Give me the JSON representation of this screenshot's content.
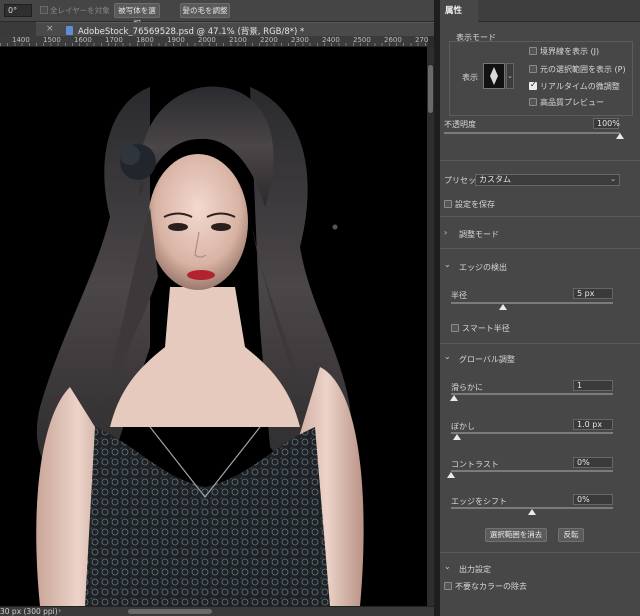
{
  "options_bar": {
    "angle_value": "0°",
    "sample_all_layers": "全レイヤーを対象",
    "select_subject": "被写体を選択",
    "refine_hair": "髪の毛を調整"
  },
  "document": {
    "tab_title": "AdobeStock_76569528.psd @ 47.1% (背景, RGB/8*) *"
  },
  "ruler": {
    "ticks": [
      "1400",
      "1500",
      "1600",
      "1700",
      "1800",
      "1900",
      "2000",
      "2100",
      "2200",
      "2300",
      "2400",
      "2500",
      "2600",
      "2700"
    ]
  },
  "status": {
    "text": "30 px (300 ppi)",
    "arrow": "›"
  },
  "panel": {
    "tab": "属性",
    "view_mode": {
      "title": "表示モード",
      "view_label": "表示",
      "show_edge": "境界線を表示 (J)",
      "show_original": "元の選択範囲を表示 (P)",
      "realtime_refine": "リアルタイムの微調整",
      "high_quality_preview": "高品質プレビュー",
      "checks": {
        "show_edge": false,
        "show_original": false,
        "realtime_refine": true,
        "high_quality_preview": false
      }
    },
    "opacity": {
      "label": "不透明度",
      "value": "100%",
      "level": 1.0
    },
    "preset": {
      "label": "プリセット",
      "value": "カスタム"
    },
    "save_settings": "設定を保存",
    "adjust_mode": "調整モード",
    "edge_detection": {
      "title": "エッジの検出",
      "radius_label": "半径",
      "radius_value": "5 px",
      "radius_level": 0.32,
      "smart_radius": "スマート半径"
    },
    "global_refine": {
      "title": "グローバル調整",
      "smooth_label": "滑らかに",
      "smooth_value": "1",
      "smooth_level": 0.02,
      "feather_label": "ぼかし",
      "feather_value": "1.0 px",
      "feather_level": 0.04,
      "contrast_label": "コントラスト",
      "contrast_value": "0%",
      "contrast_level": 0.0,
      "shift_edge_label": "エッジをシフト",
      "shift_edge_value": "0%",
      "shift_edge_level": 0.5
    },
    "clear_selection": "選択範囲を消去",
    "invert": "反転",
    "output": {
      "title": "出力設定",
      "decontaminate": "不要なカラーの除去"
    }
  }
}
